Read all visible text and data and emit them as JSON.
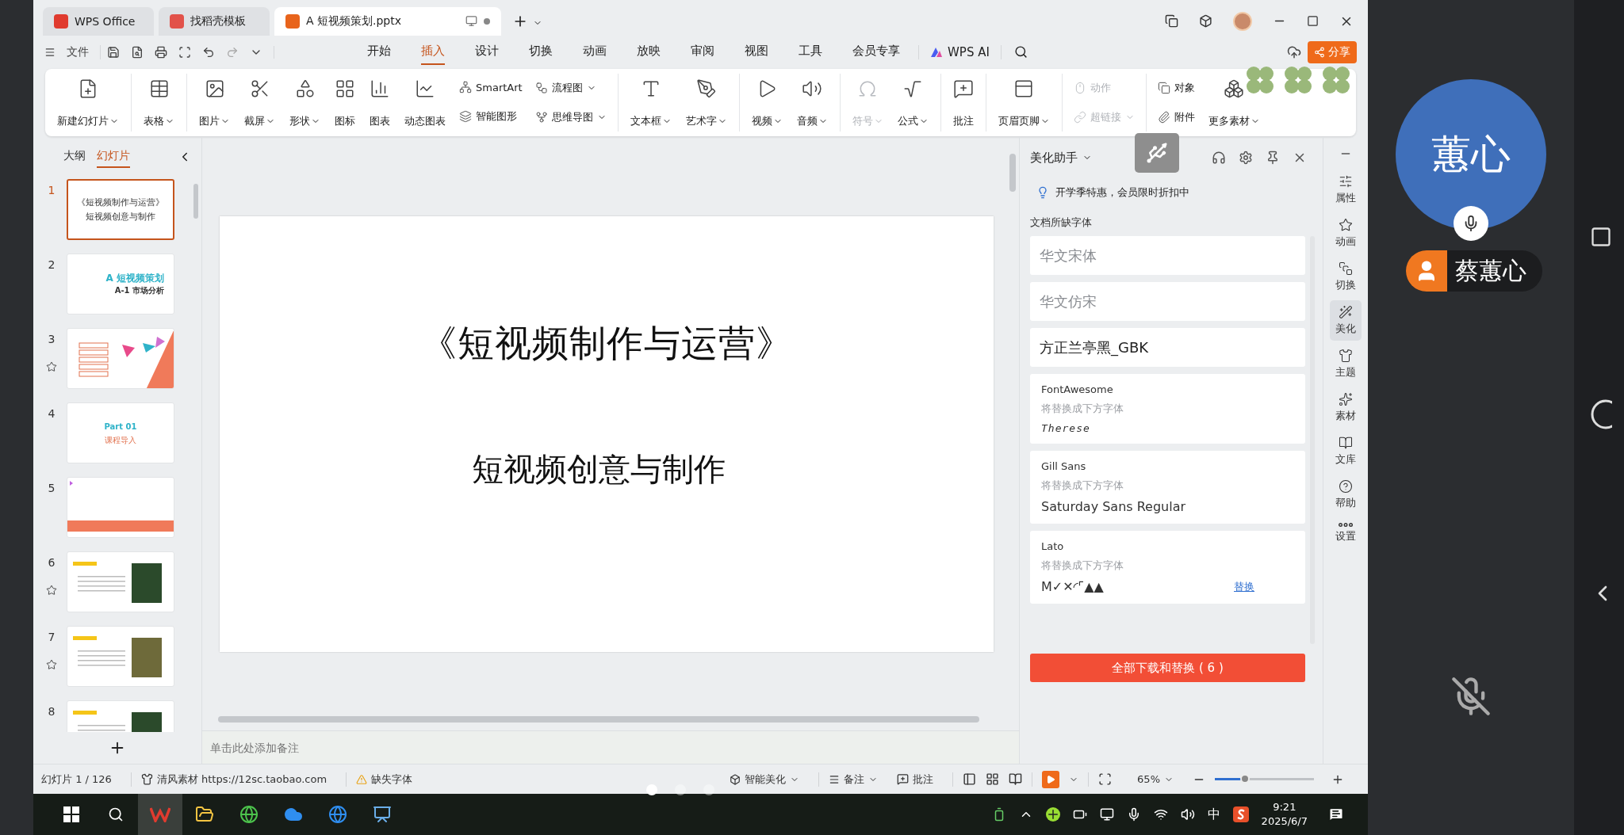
{
  "window_tabs": [
    {
      "label": "WPS Office",
      "selected": false
    },
    {
      "label": "找稻壳模板",
      "selected": false
    },
    {
      "label": "A 短视频策划.pptx",
      "selected": true
    }
  ],
  "menu": {
    "file": "文件",
    "tabs": [
      {
        "label": "开始",
        "selected": false
      },
      {
        "label": "插入",
        "selected": true
      },
      {
        "label": "设计",
        "selected": false
      },
      {
        "label": "切换",
        "selected": false
      },
      {
        "label": "动画",
        "selected": false
      },
      {
        "label": "放映",
        "selected": false
      },
      {
        "label": "审阅",
        "selected": false
      },
      {
        "label": "视图",
        "selected": false
      },
      {
        "label": "工具",
        "selected": false
      },
      {
        "label": "会员专享",
        "selected": false
      }
    ],
    "ai": "WPS AI",
    "share": "分享"
  },
  "ribbon": {
    "groups": [
      [
        {
          "kind": "large",
          "label": "新建幻灯片",
          "dropdown": true,
          "disabled": false
        }
      ],
      [
        {
          "kind": "large",
          "label": "表格",
          "dropdown": true,
          "disabled": false
        }
      ],
      [
        {
          "kind": "large",
          "label": "图片",
          "dropdown": true,
          "disabled": false
        },
        {
          "kind": "large",
          "label": "截屏",
          "dropdown": true,
          "disabled": false
        },
        {
          "kind": "large",
          "label": "形状",
          "dropdown": true,
          "disabled": false
        },
        {
          "kind": "large",
          "label": "图标",
          "dropdown": false,
          "disabled": false
        },
        {
          "kind": "large",
          "label": "图表",
          "dropdown": false,
          "disabled": false
        },
        {
          "kind": "large",
          "label": "动态图表",
          "dropdown": false,
          "disabled": false
        },
        {
          "kind": "pair",
          "items": [
            {
              "label": "SmartArt",
              "dropdown": false,
              "disabled": false
            },
            {
              "label": "智能图形",
              "dropdown": false,
              "disabled": false
            }
          ]
        },
        {
          "kind": "pair",
          "items": [
            {
              "label": "流程图",
              "dropdown": true,
              "disabled": false
            },
            {
              "label": "思维导图",
              "dropdown": true,
              "disabled": false
            }
          ]
        }
      ],
      [
        {
          "kind": "large",
          "label": "文本框",
          "dropdown": true,
          "disabled": false
        },
        {
          "kind": "large",
          "label": "艺术字",
          "dropdown": true,
          "disabled": false
        }
      ],
      [
        {
          "kind": "large",
          "label": "视频",
          "dropdown": true,
          "disabled": false
        },
        {
          "kind": "large",
          "label": "音频",
          "dropdown": true,
          "disabled": false
        }
      ],
      [
        {
          "kind": "large",
          "label": "符号",
          "dropdown": true,
          "disabled": true
        },
        {
          "kind": "large",
          "label": "公式",
          "dropdown": true,
          "disabled": false
        }
      ],
      [
        {
          "kind": "large",
          "label": "批注",
          "dropdown": false,
          "disabled": false
        }
      ],
      [
        {
          "kind": "large",
          "label": "页眉页脚",
          "dropdown": true,
          "disabled": false
        }
      ],
      [
        {
          "kind": "pair",
          "items": [
            {
              "label": "动作",
              "dropdown": false,
              "disabled": true
            },
            {
              "label": "超链接",
              "dropdown": true,
              "disabled": true
            }
          ]
        }
      ],
      [
        {
          "kind": "pair",
          "items": [
            {
              "label": "对象",
              "dropdown": false,
              "disabled": false
            },
            {
              "label": "附件",
              "dropdown": false,
              "disabled": false
            }
          ]
        },
        {
          "kind": "large",
          "label": "更多素材",
          "dropdown": true,
          "disabled": false
        }
      ]
    ]
  },
  "outline": {
    "tabs": [
      {
        "label": "大纲",
        "selected": false
      },
      {
        "label": "幻灯片",
        "selected": true
      }
    ],
    "slides": [
      {
        "number": "1",
        "selected": true,
        "starred": false,
        "kind": "title",
        "texts": [
          "《短视频制作与运营》",
          "短视频创意与制作"
        ]
      },
      {
        "number": "2",
        "selected": false,
        "starred": false,
        "kind": "cover",
        "texts": [
          "A 短视频策划",
          "A-1 市场分析"
        ]
      },
      {
        "number": "3",
        "selected": false,
        "starred": true,
        "kind": "agenda"
      },
      {
        "number": "4",
        "selected": false,
        "starred": false,
        "kind": "part",
        "texts": [
          "Part  01",
          "课程导入"
        ]
      },
      {
        "number": "5",
        "selected": false,
        "starred": false,
        "kind": "banner"
      },
      {
        "number": "6",
        "selected": false,
        "starred": true,
        "kind": "media"
      },
      {
        "number": "7",
        "selected": false,
        "starred": true,
        "kind": "media"
      },
      {
        "number": "8",
        "selected": false,
        "starred": false,
        "kind": "media"
      }
    ]
  },
  "slide": {
    "title": "《短视频制作与运营》",
    "subtitle": "短视频创意与制作"
  },
  "notes": {
    "placeholder": "单击此处添加备注"
  },
  "panel": {
    "title": "美化助手",
    "promo": "开学季特惠，会员限时折扣中",
    "section": "文档所缺字体",
    "fonts": [
      {
        "kind": "name",
        "name": "华文宋体",
        "greyed": true
      },
      {
        "kind": "name",
        "name": "华文仿宋",
        "greyed": true
      },
      {
        "kind": "name",
        "name": "方正兰亭黑_GBK",
        "greyed": false
      },
      {
        "kind": "replace",
        "name": "FontAwesome",
        "hint": "将替换成下方字体",
        "replacement": "Therese"
      },
      {
        "kind": "replace",
        "name": "Gill Sans",
        "hint": "将替换成下方字体",
        "replacement": "Saturday Sans Regular"
      },
      {
        "kind": "replace",
        "name": "Lato",
        "hint": "将替换成下方字体",
        "replacement": "M✓✕◜⌜▲▲",
        "action": "替换"
      }
    ],
    "button": "全部下载和替换 ( 6 )"
  },
  "sidebar": [
    {
      "label": "属性",
      "selected": false
    },
    {
      "label": "动画",
      "selected": false
    },
    {
      "label": "切换",
      "selected": false
    },
    {
      "label": "美化",
      "selected": true
    },
    {
      "label": "主题",
      "selected": false
    },
    {
      "label": "素材",
      "selected": false
    },
    {
      "label": "文库",
      "selected": false
    },
    {
      "label": "帮助",
      "selected": false
    },
    {
      "label": "设置",
      "selected": false
    }
  ],
  "status_bar": {
    "slide_count": "幻灯片 1 / 126",
    "source": "清风素材 https://12sc.taobao.com",
    "missing_fonts": "缺失字体",
    "smart": "智能美化",
    "notes": "备注",
    "comments": "批注",
    "zoom": "65%",
    "zoom_slider": {
      "level": 0.3
    }
  },
  "taskbar": {
    "ime": "中",
    "time": "9:21",
    "date": "2025/6/7"
  },
  "call": {
    "avatar": "蕙心",
    "name": "蔡蕙心",
    "muted": true
  }
}
